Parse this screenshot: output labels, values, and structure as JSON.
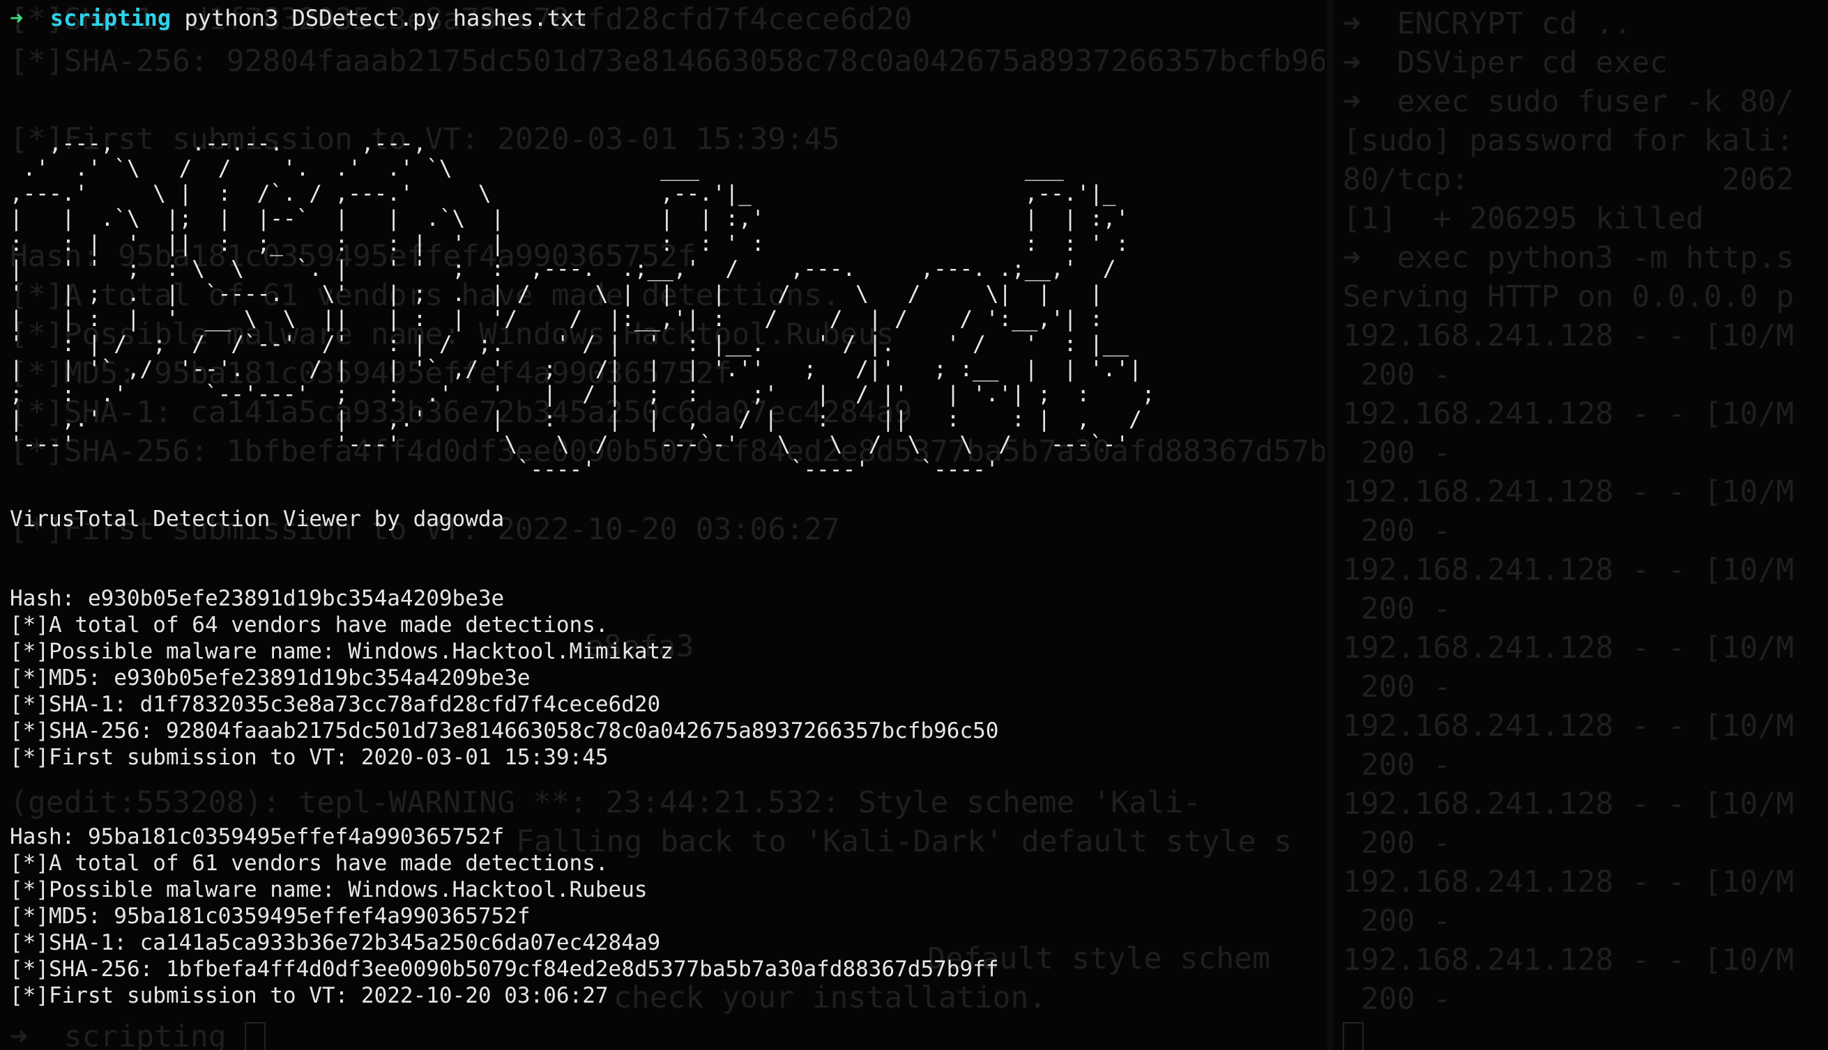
{
  "terminal": {
    "prompt": {
      "arrow": "➜",
      "directory": "scripting",
      "command": "python3 DSDetect.py hashes.txt"
    },
    "banner_art": [
      "   ,---,      .--.--.      ,---,                                                        ",
      " .'  .' `\\   /  /    '.  .'  .' `\\                ___                         ___      ",
      ",---.'     \\ |  :  /`. / ,---.'     \\             ,--.'|_                     ,--.'|_    ",
      "|   |  .`\\  |;  |  |--`  |   |  .`\\  |            |  | :,'                    |  | :,'   ",
      ":   : |  '  ||  :  ;_    :   : |  '  |            :  : ' :                    :  : ' :   ",
      "|   ' '  ;  : \\  \\    `. |   ' '  ;  :  ,---.  .;__,'  /    ,---.     ,---. .;__,'  /    ",
      "'   | ;  .  |  `----.   \\'   | ;  .  | /     \\ |  |   |    /     \\   /     \\|  |   |     ",
      "|   | :  |  '  __ \\  \\  ||   | :  |  '/    /  |:__,'| :   /    /  | /    / ':__,'| :     ",
      "'   : | /  ;  /  /`--'  /'   : | /  ;.    ' / |  '  : |__.    ' / |.    ' /   '  : |__   ",
      "|   | '` ,/  '--'.     / |   | '` ,/ '   ;   /|  |  | '.''   ;   /|'   ; :__  |  | '.'|  ",
      ";   :  .'      `--'---'  ;   :  .'   '   |  / |  ;  :    ;'   |  / |'   | '.'| ;  :    ;  ",
      "|   ,.'                  |   ,.'     |   :    |  |  ,   / |   :    ||   :    : |  ,   /   ",
      "'---'                    '---'        \\   \\  /    ---`-'   \\   \\  /  \\   \\  /   ---`-'    ",
      "                                       `----'               `----'    `----'             "
    ],
    "tagline": "VirusTotal Detection Viewer by dagowda",
    "results": [
      {
        "hash": "Hash: e930b05efe23891d19bc354a4209be3e",
        "vendors": "[*]A total of 64 vendors have made detections.",
        "malware": "[*]Possible malware name: Windows.Hacktool.Mimikatz",
        "md5": "[*]MD5: e930b05efe23891d19bc354a4209be3e",
        "sha1": "[*]SHA-1: d1f7832035c3e8a73cc78afd28cfd7f4cece6d20",
        "sha256": "[*]SHA-256: 92804faaab2175dc501d73e814663058c78c0a042675a8937266357bcfb96c50",
        "first_submission": "[*]First submission to VT: 2020-03-01 15:39:45"
      },
      {
        "hash": "Hash: 95ba181c0359495effef4a990365752f",
        "vendors": "[*]A total of 61 vendors have made detections.",
        "malware": "[*]Possible malware name: Windows.Hacktool.Rubeus",
        "md5": "[*]MD5: 95ba181c0359495effef4a990365752f",
        "sha1": "[*]SHA-1: ca141a5ca933b36e72b345a250c6da07ec4284a9",
        "sha256": "[*]SHA-256: 1bfbefa4ff4d0df3ee0090b5079cf84ed2e8d5377ba5b7a30afd88367d57b9ff",
        "first_submission": "[*]First submission to VT: 2022-10-20 03:06:27"
      }
    ]
  },
  "background_terminal_left": {
    "lines": [
      "[*]SHA-1: d1f7832035c3e8a73cc78afd28cfd7f4cece6d20",
      "[*]SHA-256: 92804faaab2175dc501d73e814663058c78c0a042675a8937266357bcfb96c50",
      "[*]First submission to VT: 2020-03-01 15:39:45",
      "Hash: 95ba181c0359495effef4a990365752f",
      "[*]A total of 61 vendors have made detections.",
      "[*]Possible malware name: Windows.Hacktool.Rubeus",
      "[*]MD5: 95ba181c0359495effef4a990365752f",
      "[*]SHA-1: ca141a5ca933b36e72b345a250c6da07ec4284a9",
      "[*]SHA-256: 1bfbefa4ff4d0df3ee0090b5079cf84ed2e8d5377ba5b7a30afd88367d57b9ff",
      "[*]First submission to VT: 2022-10-20 03:06:27",
      "e8efa3",
      "(gedit:553208): tepl-WARNING **: 23:44:21.532: Style scheme 'Kali-",
      "Falling back to 'Kali-Dark' default style s",
      "Default style schem",
      "check your installation.",
      "➜  scripting"
    ]
  },
  "background_terminal_right": {
    "lines": [
      "➜  ENCRYPT cd ..",
      "➜  DSViper cd exec",
      "➜  exec sudo fuser -k 80/",
      "[sudo] password for kali:",
      "80/tcp:              2062",
      "[1]  + 206295 killed",
      "➜  exec python3 -m http.s",
      "Serving HTTP on 0.0.0.0 p",
      "192.168.241.128 - - [10/M",
      " 200 -",
      "192.168.241.128 - - [10/M",
      " 200 -",
      "192.168.241.128 - - [10/M",
      " 200 -",
      "192.168.241.128 - - [10/M",
      " 200 -",
      "192.168.241.128 - - [10/M",
      " 200 -",
      "192.168.241.128 - - [10/M",
      " 200 -",
      "192.168.241.128 - - [10/M",
      " 200 -",
      "192.168.241.128 - - [10/M",
      " 200 -",
      "192.168.241.128 - - [10/M",
      " 200 -"
    ]
  },
  "colors": {
    "background": "#050505",
    "foreground_text": "#e6e6e6",
    "prompt_arrow": "#3ddc84",
    "prompt_directory": "#2fd1e8",
    "ghost_text": "#1f1f1f"
  }
}
